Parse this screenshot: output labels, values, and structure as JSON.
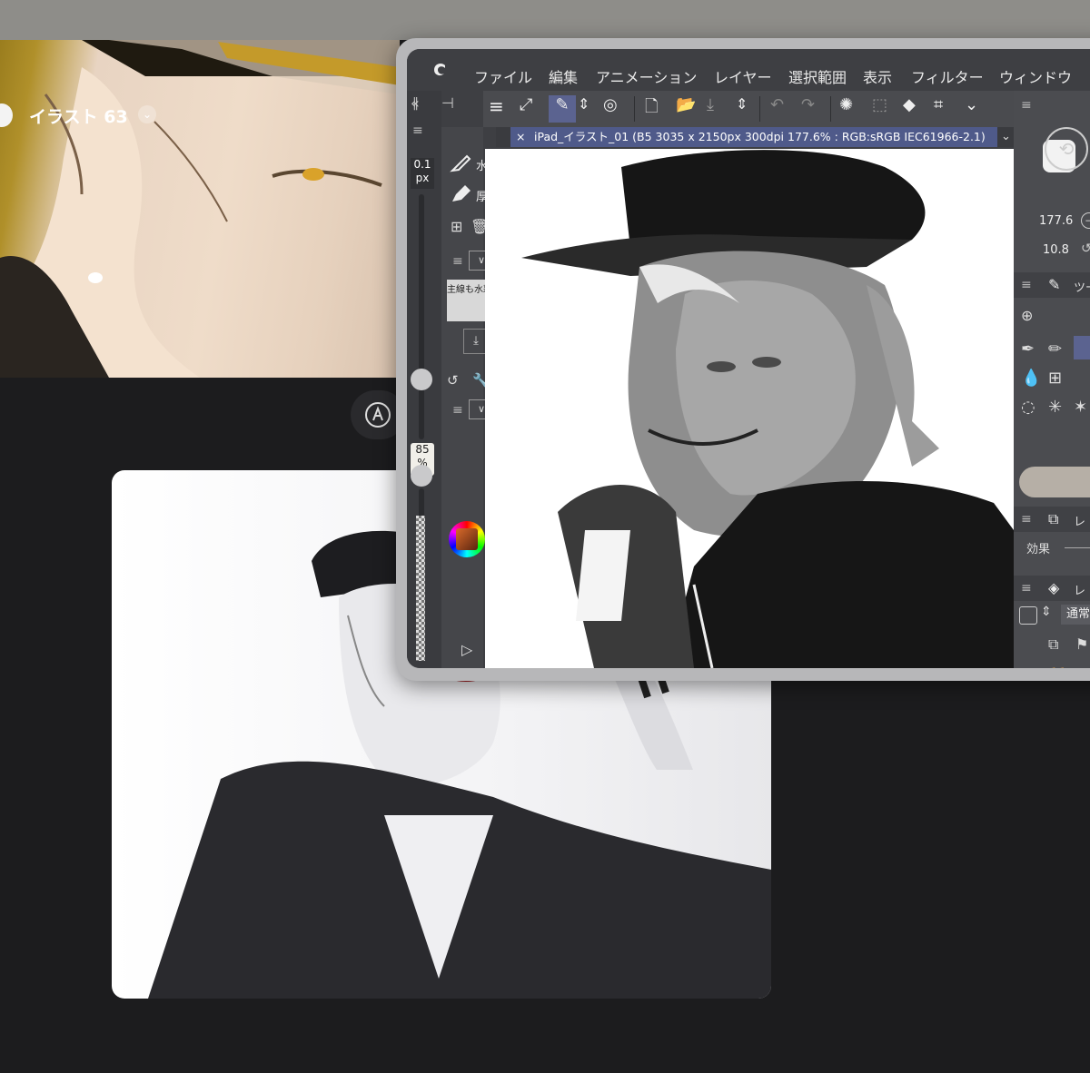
{
  "gallery": {
    "artwork_title": "イラスト 63"
  },
  "csp": {
    "menu": [
      "ファイル",
      "編集",
      "アニメーション",
      "レイヤー",
      "選択範囲",
      "表示",
      "フィルター",
      "ウィンドウ"
    ],
    "tab_title": "iPad_イラスト_01 (B5 3035 x 2150px 300dpi 177.6% : RGB:sRGB IEC61966-2.1)",
    "brush_size_value": "0.1",
    "brush_size_unit": "px",
    "opacity_value": "85",
    "opacity_unit": "%",
    "sub_tools": [
      "水",
      "厚"
    ],
    "layer_name": "主線も水彩",
    "navigator_zoom": "177.6",
    "navigator_rotate": "10.8",
    "tool_panel_label": "ツー",
    "effect_panel_label": "レ",
    "effect_label": "効果",
    "layer_panel_label": "レ",
    "blend_mode": "通常",
    "colors": {
      "accent_tab": "#4f5a8a",
      "panel": "#3e3f43",
      "window_frame": "#b7b7b9"
    }
  }
}
